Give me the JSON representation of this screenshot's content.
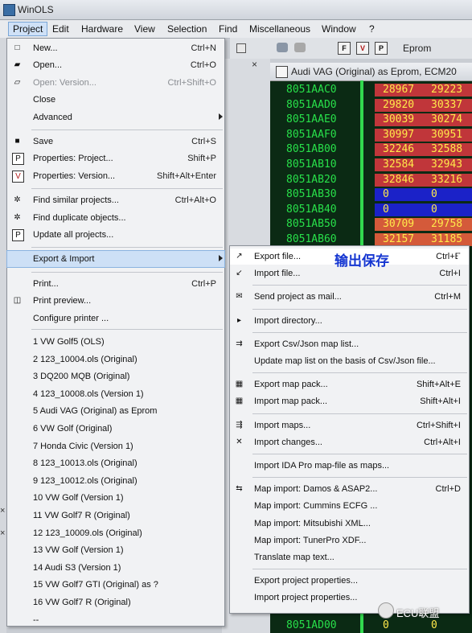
{
  "window": {
    "title": "WinOLS"
  },
  "menubar": [
    "Project",
    "Edit",
    "Hardware",
    "View",
    "Selection",
    "Find",
    "Miscellaneous",
    "Window",
    "?"
  ],
  "toolbar": {
    "label": "Eprom",
    "buttons": [
      "F",
      "V",
      "P"
    ]
  },
  "hex_window": {
    "title": "Audi VAG (Original) as Eprom, ECM20",
    "rows": [
      {
        "addr": "8051AAC0",
        "v1": "28967",
        "v2": "29223",
        "bg": "#c0363a"
      },
      {
        "addr": "8051AAD0",
        "v1": "29820",
        "v2": "30337",
        "bg": "#c0363a"
      },
      {
        "addr": "8051AAE0",
        "v1": "30039",
        "v2": "30274",
        "bg": "#c0363a"
      },
      {
        "addr": "8051AAF0",
        "v1": "30997",
        "v2": "30951",
        "bg": "#c0363a"
      },
      {
        "addr": "8051AB00",
        "v1": "32246",
        "v2": "32588",
        "bg": "#c0363a"
      },
      {
        "addr": "8051AB10",
        "v1": "32584",
        "v2": "32943",
        "bg": "#c0363a"
      },
      {
        "addr": "8051AB20",
        "v1": "32846",
        "v2": "33216",
        "bg": "#c0363a"
      },
      {
        "addr": "8051AB30",
        "v1": "0",
        "v2": "0",
        "bg": "#1b22c8"
      },
      {
        "addr": "8051AB40",
        "v1": "0",
        "v2": "0",
        "bg": "#1b22c8"
      },
      {
        "addr": "8051AB50",
        "v1": "30709",
        "v2": "29758",
        "bg": "#d45a3a"
      },
      {
        "addr": "8051AB60",
        "v1": "32157",
        "v2": "31185",
        "bg": "#d45a3a"
      }
    ],
    "bottom_row": {
      "addr": "8051AD00",
      "v1": "0",
      "v2": "0"
    }
  },
  "project_menu": [
    {
      "type": "item",
      "label": "New...",
      "shortcut": "Ctrl+N",
      "icon": "new-file-icon"
    },
    {
      "type": "item",
      "label": "Open...",
      "shortcut": "Ctrl+O",
      "icon": "open-folder-icon"
    },
    {
      "type": "item",
      "label": "Open: Version...",
      "shortcut": "Ctrl+Shift+O",
      "icon": "open-version-icon",
      "disabled": true
    },
    {
      "type": "item",
      "label": "Close",
      "shortcut": ""
    },
    {
      "type": "item",
      "label": "Advanced",
      "shortcut": "",
      "submenu": true
    },
    {
      "type": "sep"
    },
    {
      "type": "item",
      "label": "Save",
      "shortcut": "Ctrl+S",
      "icon": "save-icon"
    },
    {
      "type": "item",
      "label": "Properties: Project...",
      "shortcut": "Shift+P",
      "icon": "properties-project-icon"
    },
    {
      "type": "item",
      "label": "Properties: Version...",
      "shortcut": "Shift+Alt+Enter",
      "icon": "properties-version-icon"
    },
    {
      "type": "sep"
    },
    {
      "type": "item",
      "label": "Find similar projects...",
      "shortcut": "Ctrl+Alt+O",
      "icon": "find-similar-icon"
    },
    {
      "type": "item",
      "label": "Find duplicate objects...",
      "shortcut": "",
      "icon": "find-duplicate-icon"
    },
    {
      "type": "item",
      "label": "Update all projects...",
      "shortcut": "",
      "icon": "update-projects-icon"
    },
    {
      "type": "sep"
    },
    {
      "type": "item",
      "label": "Export & Import",
      "shortcut": "",
      "submenu": true,
      "highlight": true
    },
    {
      "type": "sep"
    },
    {
      "type": "item",
      "label": "Print...",
      "shortcut": "Ctrl+P"
    },
    {
      "type": "item",
      "label": "Print preview...",
      "shortcut": "",
      "icon": "print-preview-icon"
    },
    {
      "type": "item",
      "label": "Configure printer ...",
      "shortcut": ""
    }
  ],
  "recent_files": [
    "1 VW Golf5 (OLS)",
    "2 123_10004.ols (Original)",
    "3 DQ200 MQB (Original)",
    "4 123_10008.ols (Version 1)",
    "5 Audi VAG (Original) as Eprom",
    "6 VW Golf (Original)",
    "7 Honda Civic (Version 1)",
    "8 123_10013.ols (Original)",
    "9 123_10012.ols (Original)",
    "10 VW Golf (Version 1)",
    "11 VW Golf7 R (Original)",
    "12 123_10009.ols (Original)",
    "13 VW Golf (Version 1)",
    "14 Audi S3 (Version 1)",
    "15 VW Golf7 GTI (Original) as ?",
    "16 VW Golf7 R (Original)",
    "--"
  ],
  "export_import_menu": [
    {
      "type": "item",
      "label": "Export file...",
      "shortcut": "Ctrl+E",
      "icon": "export-file-icon",
      "highlight": true,
      "annotation": "输出保存"
    },
    {
      "type": "item",
      "label": "Import file...",
      "shortcut": "Ctrl+I",
      "icon": "import-file-icon"
    },
    {
      "type": "sep"
    },
    {
      "type": "item",
      "label": "Send project as mail...",
      "shortcut": "Ctrl+M",
      "icon": "mail-icon"
    },
    {
      "type": "sep"
    },
    {
      "type": "item",
      "label": "Import directory...",
      "shortcut": "",
      "icon": "import-directory-icon"
    },
    {
      "type": "sep"
    },
    {
      "type": "item",
      "label": "Export Csv/Json map list...",
      "shortcut": "",
      "icon": "export-csv-icon"
    },
    {
      "type": "item",
      "label": "Update map list on the basis of Csv/Json file...",
      "shortcut": ""
    },
    {
      "type": "sep"
    },
    {
      "type": "item",
      "label": "Export map pack...",
      "shortcut": "Shift+Alt+E",
      "icon": "export-map-pack-icon"
    },
    {
      "type": "item",
      "label": "Import map pack...",
      "shortcut": "Shift+Alt+I",
      "icon": "import-map-pack-icon"
    },
    {
      "type": "sep"
    },
    {
      "type": "item",
      "label": "Import maps...",
      "shortcut": "Ctrl+Shift+I",
      "icon": "import-maps-icon"
    },
    {
      "type": "item",
      "label": "Import changes...",
      "shortcut": "Ctrl+Alt+I",
      "icon": "import-changes-icon"
    },
    {
      "type": "sep"
    },
    {
      "type": "item",
      "label": "Import IDA Pro map-file as maps...",
      "shortcut": ""
    },
    {
      "type": "sep"
    },
    {
      "type": "item",
      "label": "Map import: Damos & ASAP2...",
      "shortcut": "Ctrl+D",
      "icon": "map-import-icon"
    },
    {
      "type": "item",
      "label": "Map import: Cummins ECFG ...",
      "shortcut": ""
    },
    {
      "type": "item",
      "label": "Map import: Mitsubishi XML...",
      "shortcut": ""
    },
    {
      "type": "item",
      "label": "Map import: TunerPro XDF...",
      "shortcut": ""
    },
    {
      "type": "item",
      "label": "Translate map text...",
      "shortcut": ""
    },
    {
      "type": "sep"
    },
    {
      "type": "item",
      "label": "Export project properties...",
      "shortcut": ""
    },
    {
      "type": "item",
      "label": "Import project properties...",
      "shortcut": ""
    }
  ],
  "watermark": "ECU联盟"
}
